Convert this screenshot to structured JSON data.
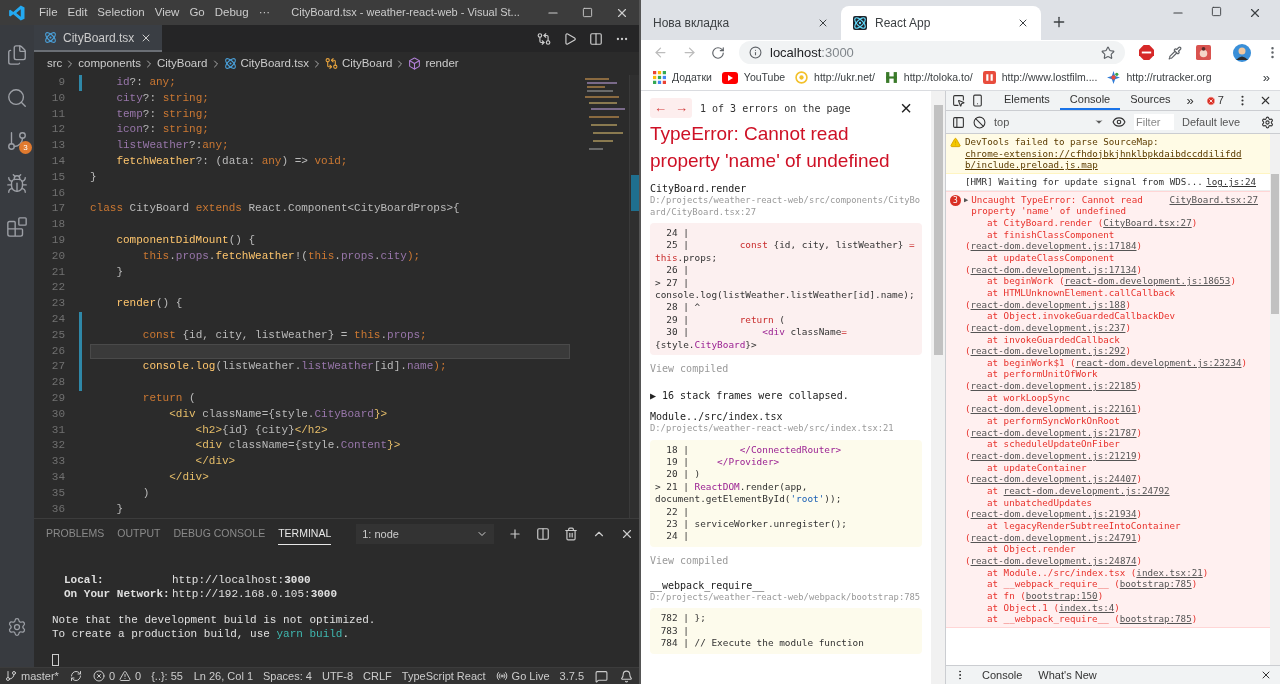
{
  "vscode": {
    "menu": [
      "File",
      "Edit",
      "Selection",
      "View",
      "Go",
      "Debug",
      "···"
    ],
    "title": "CityBoard.tsx - weather-react-web - Visual St...",
    "activity": [
      {
        "kind": "files"
      },
      {
        "kind": "search"
      },
      {
        "kind": "git",
        "badge": "3"
      },
      {
        "kind": "debug"
      },
      {
        "kind": "extensions"
      }
    ],
    "tab": {
      "label": "CityBoard.tsx"
    },
    "breadcrumbs": [
      {
        "label": "src",
        "kind": "folder"
      },
      {
        "label": "components",
        "kind": "folder"
      },
      {
        "label": "CityBoard",
        "kind": "folder"
      },
      {
        "label": "CityBoard.tsx",
        "kind": "file"
      },
      {
        "label": "CityBoard",
        "kind": "class"
      },
      {
        "label": "render",
        "kind": "method"
      }
    ],
    "lines": [
      {
        "n": "9",
        "modified": true,
        "current": false,
        "tokens": [
          {
            "text": "    id",
            "kind": "property"
          },
          {
            "text": "?: ",
            "kind": "plain"
          },
          {
            "text": "any;",
            "kind": "keyword"
          }
        ]
      },
      {
        "n": "10",
        "modified": false,
        "current": false,
        "tokens": [
          {
            "text": "    city",
            "kind": "property"
          },
          {
            "text": "?: ",
            "kind": "plain"
          },
          {
            "text": "string;",
            "kind": "keyword"
          }
        ]
      },
      {
        "n": "11",
        "modified": false,
        "current": false,
        "tokens": [
          {
            "text": "    temp",
            "kind": "property"
          },
          {
            "text": "?: ",
            "kind": "plain"
          },
          {
            "text": "string;",
            "kind": "keyword"
          }
        ]
      },
      {
        "n": "12",
        "modified": false,
        "current": false,
        "tokens": [
          {
            "text": "    icon",
            "kind": "property"
          },
          {
            "text": "?: ",
            "kind": "plain"
          },
          {
            "text": "string;",
            "kind": "keyword"
          }
        ]
      },
      {
        "n": "13",
        "modified": false,
        "current": false,
        "tokens": [
          {
            "text": "    listWeather",
            "kind": "property"
          },
          {
            "text": "?:",
            "kind": "plain"
          },
          {
            "text": "any;",
            "kind": "keyword"
          }
        ]
      },
      {
        "n": "14",
        "modified": false,
        "current": false,
        "tokens": [
          {
            "text": "    fetchWeather",
            "kind": "function"
          },
          {
            "text": "?: (data: ",
            "kind": "plain"
          },
          {
            "text": "any",
            "kind": "keyword"
          },
          {
            "text": ") => ",
            "kind": "plain"
          },
          {
            "text": "void;",
            "kind": "keyword"
          }
        ]
      },
      {
        "n": "15",
        "modified": false,
        "current": false,
        "tokens": [
          {
            "text": "}",
            "kind": "plain"
          }
        ]
      },
      {
        "n": "16",
        "modified": false,
        "current": false
      },
      {
        "n": "17",
        "modified": false,
        "current": false,
        "tokens": [
          {
            "text": "class",
            "kind": "keyword"
          },
          {
            "text": " CityBoard ",
            "kind": "plain"
          },
          {
            "text": "extends",
            "kind": "keyword"
          },
          {
            "text": " React.Component<CityBoardProps>{",
            "kind": "plain"
          }
        ]
      },
      {
        "n": "18",
        "modified": false,
        "current": false
      },
      {
        "n": "19",
        "modified": false,
        "current": false,
        "tokens": [
          {
            "text": "    componentDidMount",
            "kind": "function"
          },
          {
            "text": "() {",
            "kind": "plain"
          }
        ]
      },
      {
        "n": "20",
        "modified": false,
        "current": false,
        "tokens": [
          {
            "text": "        this",
            "kind": "keyword"
          },
          {
            "text": ".",
            "kind": "plain"
          },
          {
            "text": "props",
            "kind": "property"
          },
          {
            "text": ".",
            "kind": "plain"
          },
          {
            "text": "fetchWeather",
            "kind": "function"
          },
          {
            "text": "!(",
            "kind": "plain"
          },
          {
            "text": "this",
            "kind": "keyword"
          },
          {
            "text": ".",
            "kind": "plain"
          },
          {
            "text": "props",
            "kind": "property"
          },
          {
            "text": ".",
            "kind": "plain"
          },
          {
            "text": "city",
            "kind": "property"
          },
          {
            "text": ");",
            "kind": "keyword"
          }
        ]
      },
      {
        "n": "21",
        "modified": false,
        "current": false,
        "tokens": [
          {
            "text": "    }",
            "kind": "plain"
          }
        ]
      },
      {
        "n": "22",
        "modified": false,
        "current": false
      },
      {
        "n": "23",
        "modified": false,
        "current": false,
        "tokens": [
          {
            "text": "    render",
            "kind": "function"
          },
          {
            "text": "() {",
            "kind": "plain"
          }
        ]
      },
      {
        "n": "24",
        "modified": true,
        "current": false
      },
      {
        "n": "25",
        "modified": true,
        "current": false,
        "tokens": [
          {
            "text": "        const",
            "kind": "keyword"
          },
          {
            "text": " {id, city, listWeather} = ",
            "kind": "plain"
          },
          {
            "text": "this",
            "kind": "keyword"
          },
          {
            "text": ".",
            "kind": "plain"
          },
          {
            "text": "props",
            "kind": "property"
          },
          {
            "text": ";",
            "kind": "keyword"
          }
        ]
      },
      {
        "n": "26",
        "modified": true,
        "current": true
      },
      {
        "n": "27",
        "modified": true,
        "current": false,
        "tokens": [
          {
            "text": "        console.log",
            "kind": "function"
          },
          {
            "text": "(listWeather.",
            "kind": "plain"
          },
          {
            "text": "listWeather",
            "kind": "property"
          },
          {
            "text": "[id].",
            "kind": "plain"
          },
          {
            "text": "name",
            "kind": "property"
          },
          {
            "text": ");",
            "kind": "keyword"
          }
        ]
      },
      {
        "n": "28",
        "modified": true,
        "current": false
      },
      {
        "n": "29",
        "modified": false,
        "current": false,
        "tokens": [
          {
            "text": "        return",
            "kind": "keyword"
          },
          {
            "text": " (",
            "kind": "plain"
          }
        ]
      },
      {
        "n": "30",
        "modified": false,
        "current": false,
        "tokens": [
          {
            "text": "            <div",
            "kind": "tag"
          },
          {
            "text": " className={style.",
            "kind": "plain"
          },
          {
            "text": "CityBoard",
            "kind": "property"
          },
          {
            "text": "}>",
            "kind": "tag"
          }
        ]
      },
      {
        "n": "31",
        "modified": false,
        "current": false,
        "tokens": [
          {
            "text": "                <h2>",
            "kind": "tag"
          },
          {
            "text": "{id} {city}",
            "kind": "plain"
          },
          {
            "text": "</h2>",
            "kind": "tag"
          }
        ]
      },
      {
        "n": "32",
        "modified": false,
        "current": false,
        "tokens": [
          {
            "text": "                <div",
            "kind": "tag"
          },
          {
            "text": " className={style.",
            "kind": "plain"
          },
          {
            "text": "Content",
            "kind": "property"
          },
          {
            "text": "}>",
            "kind": "tag"
          }
        ]
      },
      {
        "n": "33",
        "modified": false,
        "current": false,
        "tokens": [
          {
            "text": "                </div>",
            "kind": "tag"
          }
        ]
      },
      {
        "n": "34",
        "modified": false,
        "current": false,
        "tokens": [
          {
            "text": "            </div>",
            "kind": "tag"
          }
        ]
      },
      {
        "n": "35",
        "modified": false,
        "current": false,
        "tokens": [
          {
            "text": "        )",
            "kind": "plain"
          }
        ]
      },
      {
        "n": "36",
        "modified": false,
        "current": false,
        "tokens": [
          {
            "text": "    }",
            "kind": "plain"
          }
        ]
      }
    ],
    "panel": {
      "tabs": [
        {
          "label": "PROBLEMS",
          "selected": false
        },
        {
          "label": "OUTPUT",
          "selected": false
        },
        {
          "label": "DEBUG CONSOLE",
          "selected": false
        },
        {
          "label": "TERMINAL",
          "selected": true
        }
      ],
      "terminal_select": "1: node",
      "addresses": [
        {
          "label": "Local:",
          "value": "http://localhost:**3000**"
        },
        {
          "label": "On Your Network:",
          "value": "http://192.168.0.105:**3000**"
        }
      ],
      "notes": [
        {
          "text": "Note that the development build is not optimized."
        },
        {
          "text": "To create a production build, use ",
          "command": "yarn build",
          "end": "."
        }
      ]
    },
    "status_left": [
      {
        "kind": "branch",
        "text": "master*"
      },
      {
        "kind": "sync"
      },
      {
        "kind": "problems",
        "errors": "0",
        "warnings": "0"
      },
      {
        "kind": "text",
        "text": "{..}: 55"
      }
    ],
    "status_right": [
      {
        "kind": "text",
        "text": "Ln 26, Col 1"
      },
      {
        "kind": "text",
        "text": "Spaces: 4"
      },
      {
        "kind": "text",
        "text": "UTF-8"
      },
      {
        "kind": "text",
        "text": "CRLF"
      },
      {
        "kind": "text",
        "text": "TypeScript React"
      },
      {
        "kind": "live",
        "text": "Go Live"
      },
      {
        "kind": "text",
        "text": "3.7.5"
      },
      {
        "kind": "feedback"
      },
      {
        "kind": "bell"
      }
    ]
  },
  "browser": {
    "tabs": [
      {
        "label": "Нова вкладка",
        "selected": false,
        "kind": "blank"
      },
      {
        "label": "React App",
        "selected": true,
        "kind": "react"
      }
    ],
    "address": {
      "host": "localhost",
      "port": ":3000"
    },
    "bookmarks": [
      {
        "label": "Додатки",
        "kind": "apps"
      },
      {
        "label": "YouTube",
        "kind": "youtube"
      },
      {
        "label": "http://ukr.net/",
        "kind": "ukr"
      },
      {
        "label": "http://toloka.to/",
        "kind": "toloka"
      },
      {
        "label": "http://www.lostfilm....",
        "kind": "lostfilm"
      },
      {
        "label": "http://rutracker.org",
        "kind": "rutracker"
      }
    ],
    "bookmarks_more": "»"
  },
  "overlay": {
    "nav": [
      "←",
      "→"
    ],
    "counter": "1 of 3 errors on the page",
    "close": "×",
    "title": "TypeError: Cannot read property 'name' of undefined",
    "frames": [
      {
        "kind": "error",
        "name": "CityBoard.render",
        "path": "D:/projects/weather-react-web/src/components/CityBoard/CityBoard.tsx:27",
        "link": "View compiled",
        "lines": [
          {
            "g": "  24 | "
          },
          {
            "g": "  25 |         ",
            "tokens": [
              {
                "text": "const",
                "kind": "keyword"
              },
              {
                "text": " {id, city, listWeather} ",
                "kind": "plain"
              },
              {
                "text": "= this",
                "kind": "keyword"
              },
              {
                "text": ".props;",
                "kind": "plain"
              }
            ]
          },
          {
            "g": "  26 | "
          },
          {
            "g": "> 27 | ",
            "tokens": [
              {
                "text": "        console.log(listWeather.listWeather[id].name);",
                "kind": "plain"
              }
            ]
          },
          {
            "g": "  28 | ^"
          },
          {
            "g": "  29 |         ",
            "tokens": [
              {
                "text": "return",
                "kind": "keyword"
              },
              {
                "text": " (",
                "kind": "plain"
              }
            ]
          },
          {
            "g": "  30 |             ",
            "tokens": [
              {
                "text": "<div",
                "kind": "tag"
              },
              {
                "text": " className",
                "kind": "plain"
              },
              {
                "text": "=",
                "kind": "keyword"
              },
              {
                "text": "{style.",
                "kind": "plain"
              },
              {
                "text": "CityBoard",
                "kind": "tag"
              },
              {
                "text": "}>",
                "kind": "plain"
              }
            ]
          }
        ]
      },
      {
        "kind": "context",
        "name": "Module../src/index.tsx",
        "path": "D:/projects/weather-react-web/src/index.tsx:21",
        "link": "View compiled",
        "lines": [
          {
            "g": "  18 |         ",
            "tokens": [
              {
                "text": "</ConnectedRouter>",
                "kind": "tag"
              }
            ]
          },
          {
            "g": "  19 |     ",
            "tokens": [
              {
                "text": "</Provider>",
                "kind": "tag"
              }
            ]
          },
          {
            "g": "  20 | )"
          },
          {
            "g": "> 21 | ",
            "tokens": [
              {
                "text": "ReactDOM",
                "kind": "tag"
              },
              {
                "text": ".render(app, document.getElementById(",
                "kind": "plain"
              },
              {
                "text": "'root'",
                "kind": "string"
              },
              {
                "text": "));",
                "kind": "plain"
              }
            ]
          },
          {
            "g": "  22 | "
          },
          {
            "g": "  23 | ",
            "tokens": [
              {
                "text": "serviceWorker.unregister();",
                "kind": "plain"
              }
            ]
          },
          {
            "g": "  24 | "
          }
        ]
      },
      {
        "kind": "context",
        "name": "__webpack_require__",
        "path": "D:/projects/weather-react-web/webpack/bootstrap:785",
        "lines": [
          {
            "g": " 782 | };"
          },
          {
            "g": " 783 | "
          },
          {
            "g": " 784 | ",
            "tokens": [
              {
                "text": "// Execute the module function",
                "kind": "plain"
              }
            ]
          }
        ]
      }
    ],
    "collapsed": "▶ 16 stack frames were collapsed."
  },
  "devtools": {
    "tabs": [
      {
        "label": "Elements",
        "selected": false
      },
      {
        "label": "Console",
        "selected": true
      },
      {
        "label": "Sources",
        "selected": false
      }
    ],
    "more": "»",
    "error_count": "7",
    "context": "top",
    "filter_placeholder": "Filter",
    "levels": "Default leve",
    "messages": [
      {
        "kind": "warning",
        "text": "DevTools failed to parse SourceMap: ",
        "link": "chrome-extension://cfhdojbkjhnklbpkdaibdccddilifddb/include.preload.js.map"
      },
      {
        "kind": "info",
        "text": "[HMR] Waiting for update signal from WDS...",
        "source": "log.js:24"
      },
      {
        "kind": "error",
        "count": "3",
        "toggle": "▶",
        "text": "Uncaught TypeError: Cannot read property 'name' of undefined",
        "source": "CityBoard.tsx:27",
        "frames": [
          {
            "prefix": "at CityBoard.render (",
            "link": "CityBoard.tsx:27",
            "suffix": ")"
          },
          {
            "prefix": "at finishClassComponent (",
            "link": "react-dom.development.js:17184",
            "suffix": ")"
          },
          {
            "prefix": "at updateClassComponent (",
            "link": "react-dom.development.js:17134",
            "suffix": ")"
          },
          {
            "prefix": "at beginWork (",
            "link": "react-dom.development.js:18653",
            "suffix": ")"
          },
          {
            "prefix": "at HTMLUnknownElement.callCallback (",
            "link": "react-dom.development.js:188",
            "suffix": ")"
          },
          {
            "prefix": "at Object.invokeGuardedCallbackDev (",
            "link": "react-dom.development.js:237",
            "suffix": ")"
          },
          {
            "prefix": "at invokeGuardedCallback (",
            "link": "react-dom.development.js:292",
            "suffix": ")"
          },
          {
            "prefix": "at beginWork$1 (",
            "link": "react-dom.development.js:23234",
            "suffix": ")"
          },
          {
            "prefix": "at performUnitOfWork (",
            "link": "react-dom.development.js:22185",
            "suffix": ")"
          },
          {
            "prefix": "at workLoopSync (",
            "link": "react-dom.development.js:22161",
            "suffix": ")"
          },
          {
            "prefix": "at performSyncWorkOnRoot (",
            "link": "react-dom.development.js:21787",
            "suffix": ")"
          },
          {
            "prefix": "at scheduleUpdateOnFiber (",
            "link": "react-dom.development.js:21219",
            "suffix": ")"
          },
          {
            "prefix": "at updateContainer (",
            "link": "react-dom.development.js:24407",
            "suffix": ")"
          },
          {
            "prefix": "at ",
            "link": "react-dom.development.js:24792"
          },
          {
            "prefix": "at unbatchedUpdates (",
            "link": "react-dom.development.js:21934",
            "suffix": ")"
          },
          {
            "prefix": "at legacyRenderSubtreeIntoContainer (",
            "link": "react-dom.development.js:24791",
            "suffix": ")"
          },
          {
            "prefix": "at Object.render (",
            "link": "react-dom.development.js:24874",
            "suffix": ")"
          },
          {
            "prefix": "at Module../src/index.tsx (",
            "link": "index.tsx:21",
            "suffix": ")"
          },
          {
            "prefix": "at __webpack_require__ (",
            "link": "bootstrap:785",
            "suffix": ")"
          },
          {
            "prefix": "at fn (",
            "link": "bootstrap:150",
            "suffix": ")"
          },
          {
            "prefix": "at Object.1 (",
            "link": "index.ts:4",
            "suffix": ")"
          },
          {
            "prefix": "at __webpack_require__ (",
            "link": "bootstrap:785",
            "suffix": ")"
          }
        ]
      }
    ],
    "drawer": {
      "tabs": [
        "Console",
        "What's New"
      ]
    }
  }
}
